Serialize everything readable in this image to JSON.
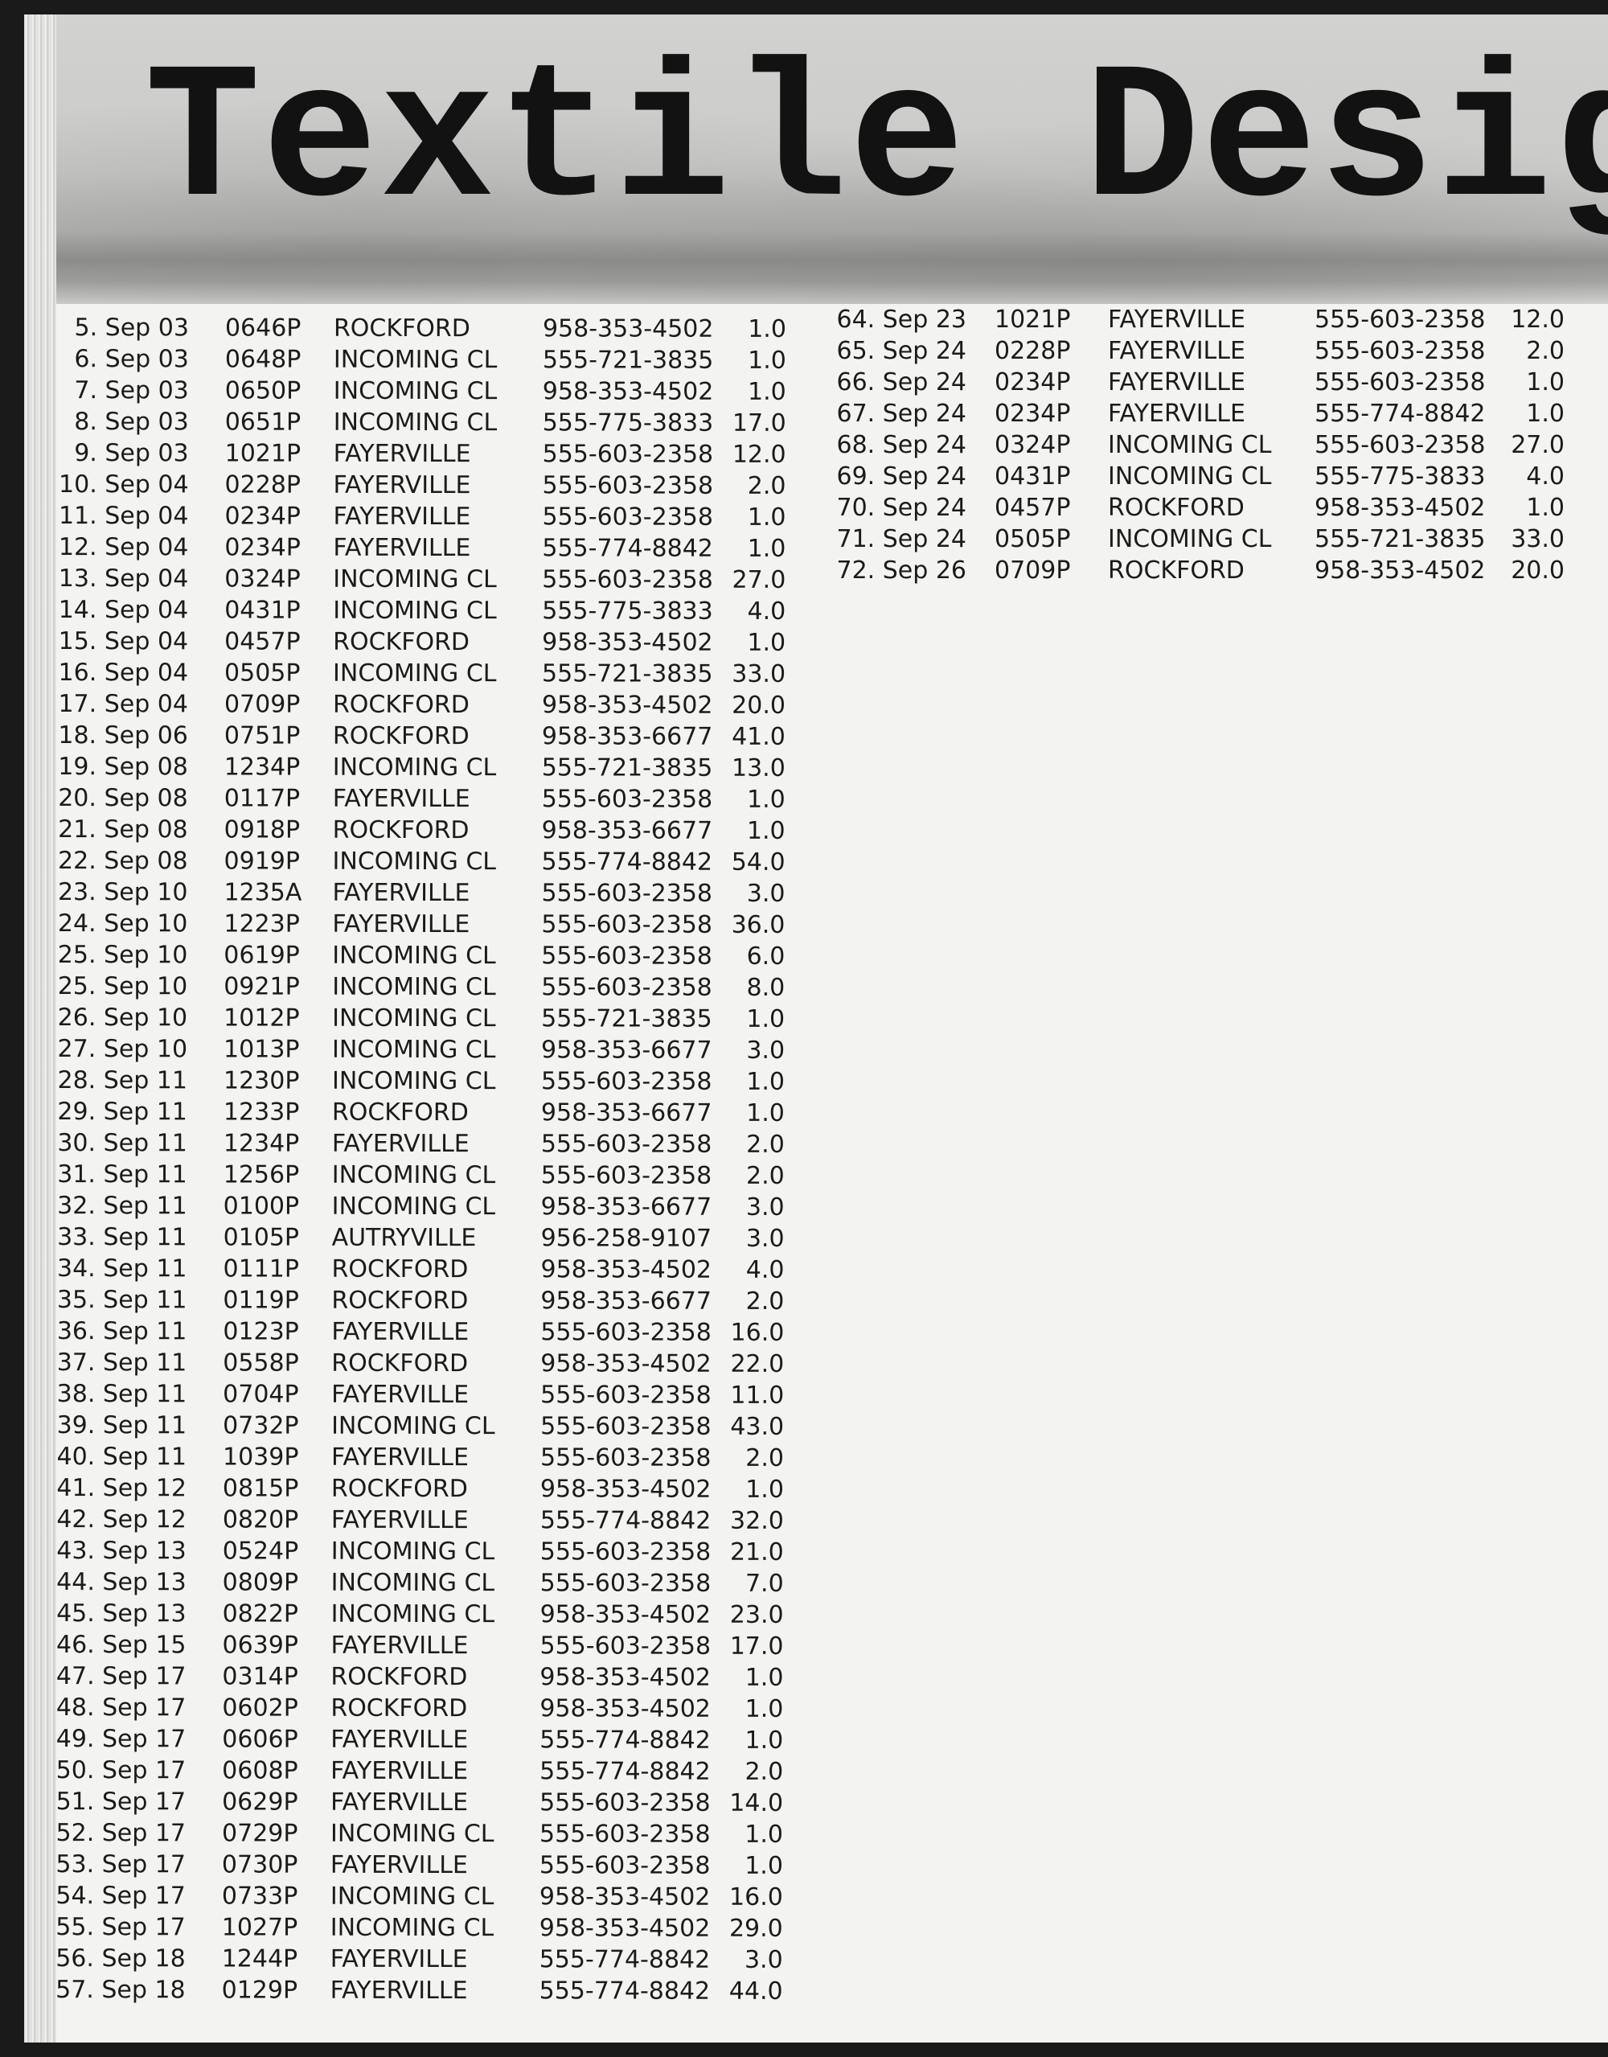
{
  "title": "Textile Design",
  "colors": {
    "page": "#f3f3f1",
    "header_band": "#c8c8c6",
    "text": "#1b1b1b",
    "title": "#121212"
  },
  "left_rows": [
    {
      "date": "5. Sep 03",
      "time": "0646P",
      "place": "ROCKFORD",
      "phone": "958-353-4502",
      "mins": "1.0"
    },
    {
      "date": "6. Sep 03",
      "time": "0648P",
      "place": "INCOMING CL",
      "phone": "555-721-3835",
      "mins": "1.0"
    },
    {
      "date": "7. Sep 03",
      "time": "0650P",
      "place": "INCOMING CL",
      "phone": "958-353-4502",
      "mins": "1.0"
    },
    {
      "date": "8. Sep 03",
      "time": "0651P",
      "place": "INCOMING CL",
      "phone": "555-775-3833",
      "mins": "17.0"
    },
    {
      "date": "9. Sep 03",
      "time": "1021P",
      "place": "FAYERVILLE",
      "phone": "555-603-2358",
      "mins": "12.0"
    },
    {
      "date": "10. Sep 04",
      "time": "0228P",
      "place": "FAYERVILLE",
      "phone": "555-603-2358",
      "mins": "2.0"
    },
    {
      "date": "11. Sep 04",
      "time": "0234P",
      "place": "FAYERVILLE",
      "phone": "555-603-2358",
      "mins": "1.0"
    },
    {
      "date": "12. Sep 04",
      "time": "0234P",
      "place": "FAYERVILLE",
      "phone": "555-774-8842",
      "mins": "1.0"
    },
    {
      "date": "13. Sep 04",
      "time": "0324P",
      "place": "INCOMING CL",
      "phone": "555-603-2358",
      "mins": "27.0"
    },
    {
      "date": "14. Sep 04",
      "time": "0431P",
      "place": "INCOMING CL",
      "phone": "555-775-3833",
      "mins": "4.0"
    },
    {
      "date": "15. Sep 04",
      "time": "0457P",
      "place": "ROCKFORD",
      "phone": "958-353-4502",
      "mins": "1.0"
    },
    {
      "date": "16. Sep 04",
      "time": "0505P",
      "place": "INCOMING CL",
      "phone": "555-721-3835",
      "mins": "33.0"
    },
    {
      "date": "17. Sep 04",
      "time": "0709P",
      "place": "ROCKFORD",
      "phone": "958-353-4502",
      "mins": "20.0"
    },
    {
      "date": "18. Sep 06",
      "time": "0751P",
      "place": "ROCKFORD",
      "phone": "958-353-6677",
      "mins": "41.0"
    },
    {
      "date": "19. Sep 08",
      "time": "1234P",
      "place": "INCOMING CL",
      "phone": "555-721-3835",
      "mins": "13.0"
    },
    {
      "date": "20. Sep 08",
      "time": "0117P",
      "place": "FAYERVILLE",
      "phone": "555-603-2358",
      "mins": "1.0"
    },
    {
      "date": "21. Sep 08",
      "time": "0918P",
      "place": "ROCKFORD",
      "phone": "958-353-6677",
      "mins": "1.0"
    },
    {
      "date": "22. Sep 08",
      "time": "0919P",
      "place": "INCOMING CL",
      "phone": "555-774-8842",
      "mins": "54.0"
    },
    {
      "date": "23. Sep 10",
      "time": "1235A",
      "place": "FAYERVILLE",
      "phone": "555-603-2358",
      "mins": "3.0"
    },
    {
      "date": "24. Sep 10",
      "time": "1223P",
      "place": "FAYERVILLE",
      "phone": "555-603-2358",
      "mins": "36.0"
    },
    {
      "date": "25. Sep 10",
      "time": "0619P",
      "place": "INCOMING CL",
      "phone": "555-603-2358",
      "mins": "6.0"
    },
    {
      "date": "25. Sep 10",
      "time": "0921P",
      "place": "INCOMING CL",
      "phone": "555-603-2358",
      "mins": "8.0"
    },
    {
      "date": "26. Sep 10",
      "time": "1012P",
      "place": "INCOMING CL",
      "phone": "555-721-3835",
      "mins": "1.0"
    },
    {
      "date": "27. Sep 10",
      "time": "1013P",
      "place": "INCOMING CL",
      "phone": "958-353-6677",
      "mins": "3.0"
    },
    {
      "date": "28. Sep 11",
      "time": "1230P",
      "place": "INCOMING CL",
      "phone": "555-603-2358",
      "mins": "1.0"
    },
    {
      "date": "29. Sep 11",
      "time": "1233P",
      "place": "ROCKFORD",
      "phone": "958-353-6677",
      "mins": "1.0"
    },
    {
      "date": "30. Sep 11",
      "time": "1234P",
      "place": "FAYERVILLE",
      "phone": "555-603-2358",
      "mins": "2.0"
    },
    {
      "date": "31. Sep 11",
      "time": "1256P",
      "place": "INCOMING CL",
      "phone": "555-603-2358",
      "mins": "2.0"
    },
    {
      "date": "32. Sep 11",
      "time": "0100P",
      "place": "INCOMING CL",
      "phone": "958-353-6677",
      "mins": "3.0"
    },
    {
      "date": "33. Sep 11",
      "time": "0105P",
      "place": "AUTRYVILLE",
      "phone": "956-258-9107",
      "mins": "3.0"
    },
    {
      "date": "34. Sep 11",
      "time": "0111P",
      "place": "ROCKFORD",
      "phone": "958-353-4502",
      "mins": "4.0"
    },
    {
      "date": "35. Sep 11",
      "time": "0119P",
      "place": "ROCKFORD",
      "phone": "958-353-6677",
      "mins": "2.0"
    },
    {
      "date": "36. Sep 11",
      "time": "0123P",
      "place": "FAYERVILLE",
      "phone": "555-603-2358",
      "mins": "16.0"
    },
    {
      "date": "37. Sep 11",
      "time": "0558P",
      "place": "ROCKFORD",
      "phone": "958-353-4502",
      "mins": "22.0"
    },
    {
      "date": "38. Sep 11",
      "time": "0704P",
      "place": "FAYERVILLE",
      "phone": "555-603-2358",
      "mins": "11.0"
    },
    {
      "date": "39. Sep 11",
      "time": "0732P",
      "place": "INCOMING CL",
      "phone": "555-603-2358",
      "mins": "43.0"
    },
    {
      "date": "40. Sep 11",
      "time": "1039P",
      "place": "FAYERVILLE",
      "phone": "555-603-2358",
      "mins": "2.0"
    },
    {
      "date": "41. Sep 12",
      "time": "0815P",
      "place": "ROCKFORD",
      "phone": "958-353-4502",
      "mins": "1.0"
    },
    {
      "date": "42. Sep 12",
      "time": "0820P",
      "place": "FAYERVILLE",
      "phone": "555-774-8842",
      "mins": "32.0"
    },
    {
      "date": "43. Sep 13",
      "time": "0524P",
      "place": "INCOMING CL",
      "phone": "555-603-2358",
      "mins": "21.0"
    },
    {
      "date": "44. Sep 13",
      "time": "0809P",
      "place": "INCOMING CL",
      "phone": "555-603-2358",
      "mins": "7.0"
    },
    {
      "date": "45. Sep 13",
      "time": "0822P",
      "place": "INCOMING CL",
      "phone": "958-353-4502",
      "mins": "23.0"
    },
    {
      "date": "46. Sep 15",
      "time": "0639P",
      "place": "FAYERVILLE",
      "phone": "555-603-2358",
      "mins": "17.0"
    },
    {
      "date": "47. Sep 17",
      "time": "0314P",
      "place": "ROCKFORD",
      "phone": "958-353-4502",
      "mins": "1.0"
    },
    {
      "date": "48. Sep 17",
      "time": "0602P",
      "place": "ROCKFORD",
      "phone": "958-353-4502",
      "mins": "1.0"
    },
    {
      "date": "49. Sep 17",
      "time": "0606P",
      "place": "FAYERVILLE",
      "phone": "555-774-8842",
      "mins": "1.0"
    },
    {
      "date": "50. Sep 17",
      "time": "0608P",
      "place": "FAYERVILLE",
      "phone": "555-774-8842",
      "mins": "2.0"
    },
    {
      "date": "51. Sep 17",
      "time": "0629P",
      "place": "FAYERVILLE",
      "phone": "555-603-2358",
      "mins": "14.0"
    },
    {
      "date": "52. Sep 17",
      "time": "0729P",
      "place": "INCOMING CL",
      "phone": "555-603-2358",
      "mins": "1.0"
    },
    {
      "date": "53. Sep 17",
      "time": "0730P",
      "place": "FAYERVILLE",
      "phone": "555-603-2358",
      "mins": "1.0"
    },
    {
      "date": "54. Sep 17",
      "time": "0733P",
      "place": "INCOMING CL",
      "phone": "958-353-4502",
      "mins": "16.0"
    },
    {
      "date": "55. Sep 17",
      "time": "1027P",
      "place": "INCOMING CL",
      "phone": "958-353-4502",
      "mins": "29.0"
    },
    {
      "date": "56. Sep 18",
      "time": "1244P",
      "place": "FAYERVILLE",
      "phone": "555-774-8842",
      "mins": "3.0"
    },
    {
      "date": "57. Sep 18",
      "time": "0129P",
      "place": "FAYERVILLE",
      "phone": "555-774-8842",
      "mins": "44.0"
    }
  ],
  "right_rows": [
    {
      "date": "64. Sep 23",
      "time": "1021P",
      "place": "FAYERVILLE",
      "phone": "555-603-2358",
      "mins": "12.0"
    },
    {
      "date": "65. Sep 24",
      "time": "0228P",
      "place": "FAYERVILLE",
      "phone": "555-603-2358",
      "mins": "2.0"
    },
    {
      "date": "66. Sep 24",
      "time": "0234P",
      "place": "FAYERVILLE",
      "phone": "555-603-2358",
      "mins": "1.0"
    },
    {
      "date": "67. Sep 24",
      "time": "0234P",
      "place": "FAYERVILLE",
      "phone": "555-774-8842",
      "mins": "1.0"
    },
    {
      "date": "68. Sep 24",
      "time": "0324P",
      "place": "INCOMING CL",
      "phone": "555-603-2358",
      "mins": "27.0"
    },
    {
      "date": "69. Sep 24",
      "time": "0431P",
      "place": "INCOMING CL",
      "phone": "555-775-3833",
      "mins": "4.0"
    },
    {
      "date": "70. Sep 24",
      "time": "0457P",
      "place": "ROCKFORD",
      "phone": "958-353-4502",
      "mins": "1.0"
    },
    {
      "date": "71. Sep 24",
      "time": "0505P",
      "place": "INCOMING CL",
      "phone": "555-721-3835",
      "mins": "33.0"
    },
    {
      "date": "72. Sep 26",
      "time": "0709P",
      "place": "ROCKFORD",
      "phone": "958-353-4502",
      "mins": "20.0"
    }
  ]
}
